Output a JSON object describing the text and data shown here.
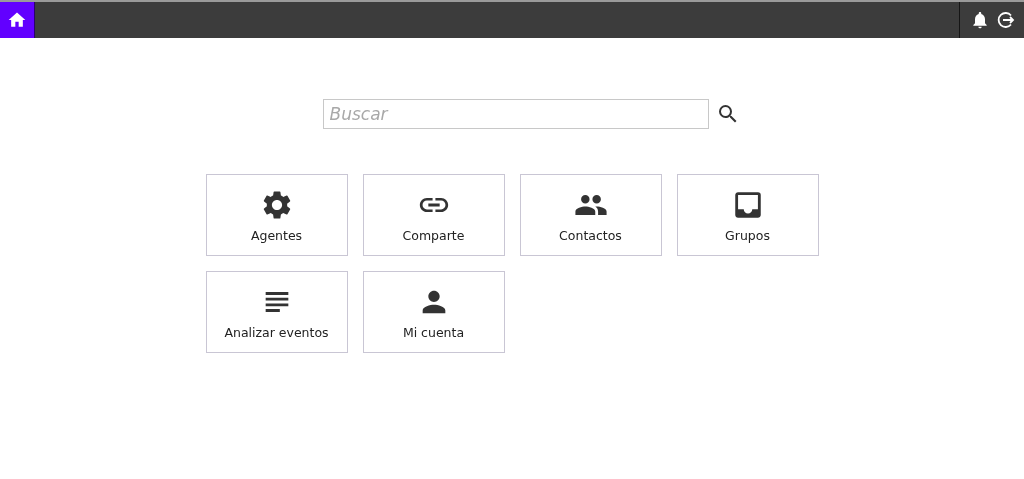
{
  "search": {
    "placeholder": "Buscar"
  },
  "tiles": [
    {
      "kind": "gear",
      "label": "Agentes"
    },
    {
      "kind": "link",
      "label": "Comparte"
    },
    {
      "kind": "people",
      "label": "Contactos"
    },
    {
      "kind": "inbox",
      "label": "Grupos"
    },
    {
      "kind": "lines",
      "label": "Analizar eventos"
    },
    {
      "kind": "person",
      "label": "Mi cuenta"
    }
  ]
}
